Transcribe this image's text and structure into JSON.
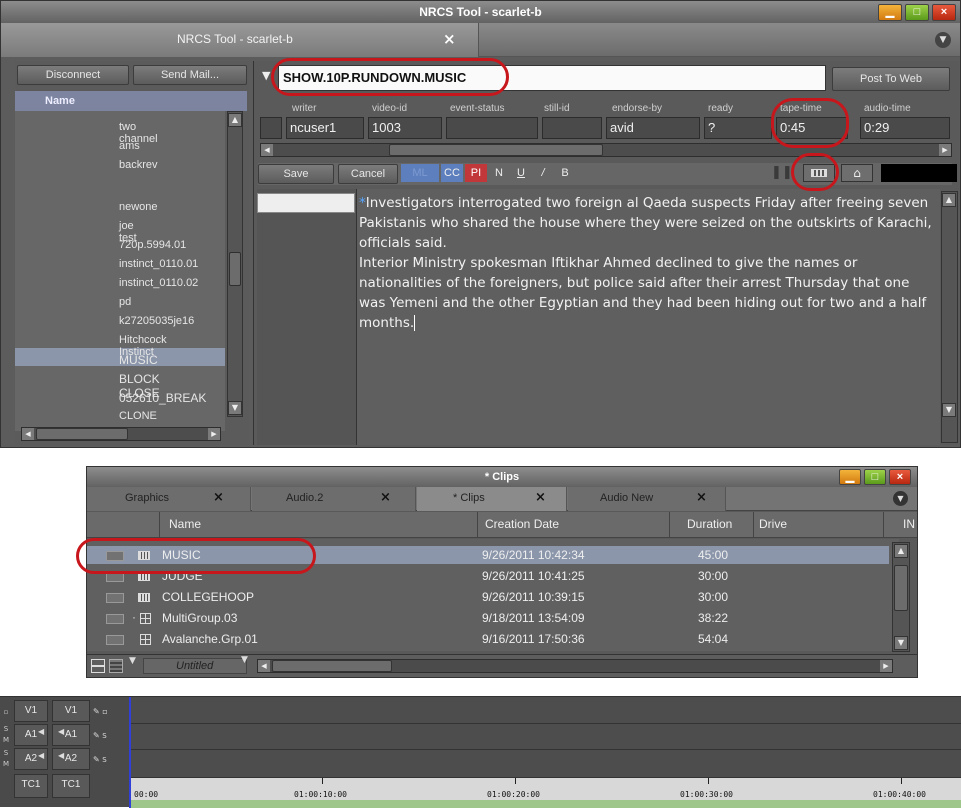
{
  "nrcs": {
    "window_title": "NRCS Tool - scarlet-b",
    "tab_title": "NRCS Tool - scarlet-b",
    "tab_close": "×",
    "disconnect_label": "Disconnect",
    "send_mail_label": "Send Mail...",
    "name_header": "Name",
    "list_items": [
      "two channel",
      "ams",
      "backrev",
      "",
      "newone",
      "joe test",
      "720p.5994.01",
      "instinct_0110.01",
      "instinct_0110.02",
      "pd",
      "k27205035je16",
      "Hitchcock Instinct",
      "MUSIC",
      "BLOCK CLOSE",
      "052610_BREAK",
      "CLONE"
    ],
    "selected_item": "MUSIC",
    "slug": "SHOW.10P.RUNDOWN.MUSIC",
    "post_to_web_label": "Post To Web",
    "fields": [
      {
        "label": "writer",
        "value": "ncuser1"
      },
      {
        "label": "video-id",
        "value": "1003"
      },
      {
        "label": "event-status",
        "value": ""
      },
      {
        "label": "still-id",
        "value": ""
      },
      {
        "label": "endorse-by",
        "value": "avid"
      },
      {
        "label": "ready",
        "value": "?"
      },
      {
        "label": "tape-time",
        "value": "0:45"
      },
      {
        "label": "audio-time",
        "value": "0:29"
      }
    ],
    "save_label": "Save",
    "cancel_label": "Cancel",
    "format_buttons": [
      "ML",
      "CC",
      "PI",
      "N",
      "U",
      "/",
      "B"
    ],
    "story_marker": "*",
    "story_text_1": "Investigators interrogated two foreign al Qaeda suspects Friday after freeing seven Pakistanis who shared the house where they were seized on the outskirts of Karachi, officials said.",
    "story_text_2": "Interior Ministry spokesman Iftikhar Ahmed declined to give the names or nationalities of the foreigners, but police said after their arrest Thursday that one was Yemeni and the other Egyptian and they had been hiding out for two and a half months."
  },
  "clips": {
    "window_title": "* Clips",
    "tabs": [
      {
        "label": "Graphics",
        "close": "×"
      },
      {
        "label": "Audio.2",
        "close": "×"
      },
      {
        "label": "* Clips",
        "close": "×"
      },
      {
        "label": "Audio New",
        "close": "×"
      }
    ],
    "columns": [
      "Name",
      "Creation Date",
      "Duration",
      "Drive",
      "IN"
    ],
    "rows": [
      {
        "name": "MUSIC",
        "date": "9/26/2011 10:42:34",
        "duration": "45:00",
        "icon": "sequence-icon"
      },
      {
        "name": "JUDGE",
        "date": "9/26/2011 10:41:25",
        "duration": "30:00",
        "icon": "sequence-icon"
      },
      {
        "name": "COLLEGEHOOP",
        "date": "9/26/2011 10:39:15",
        "duration": "30:00",
        "icon": "sequence-icon"
      },
      {
        "name": "MultiGroup.03",
        "date": "9/18/2011 13:54:09",
        "duration": "38:22",
        "icon": "group-icon"
      },
      {
        "name": "Avalanche.Grp.01",
        "date": "9/16/2011 17:50:36",
        "duration": "54:04",
        "icon": "group-icon"
      }
    ],
    "view_label": "Untitled"
  },
  "timeline": {
    "tracks": [
      {
        "src": "V1",
        "rec": "V1"
      },
      {
        "src": "A1",
        "rec": "A1"
      },
      {
        "src": "A2",
        "rec": "A2"
      },
      {
        "src": "TC1",
        "rec": "TC1"
      }
    ],
    "timecodes": [
      "00:00",
      "01:00:10:00",
      "01:00:20:00",
      "01:00:30:00",
      "01:00:40:00"
    ]
  }
}
